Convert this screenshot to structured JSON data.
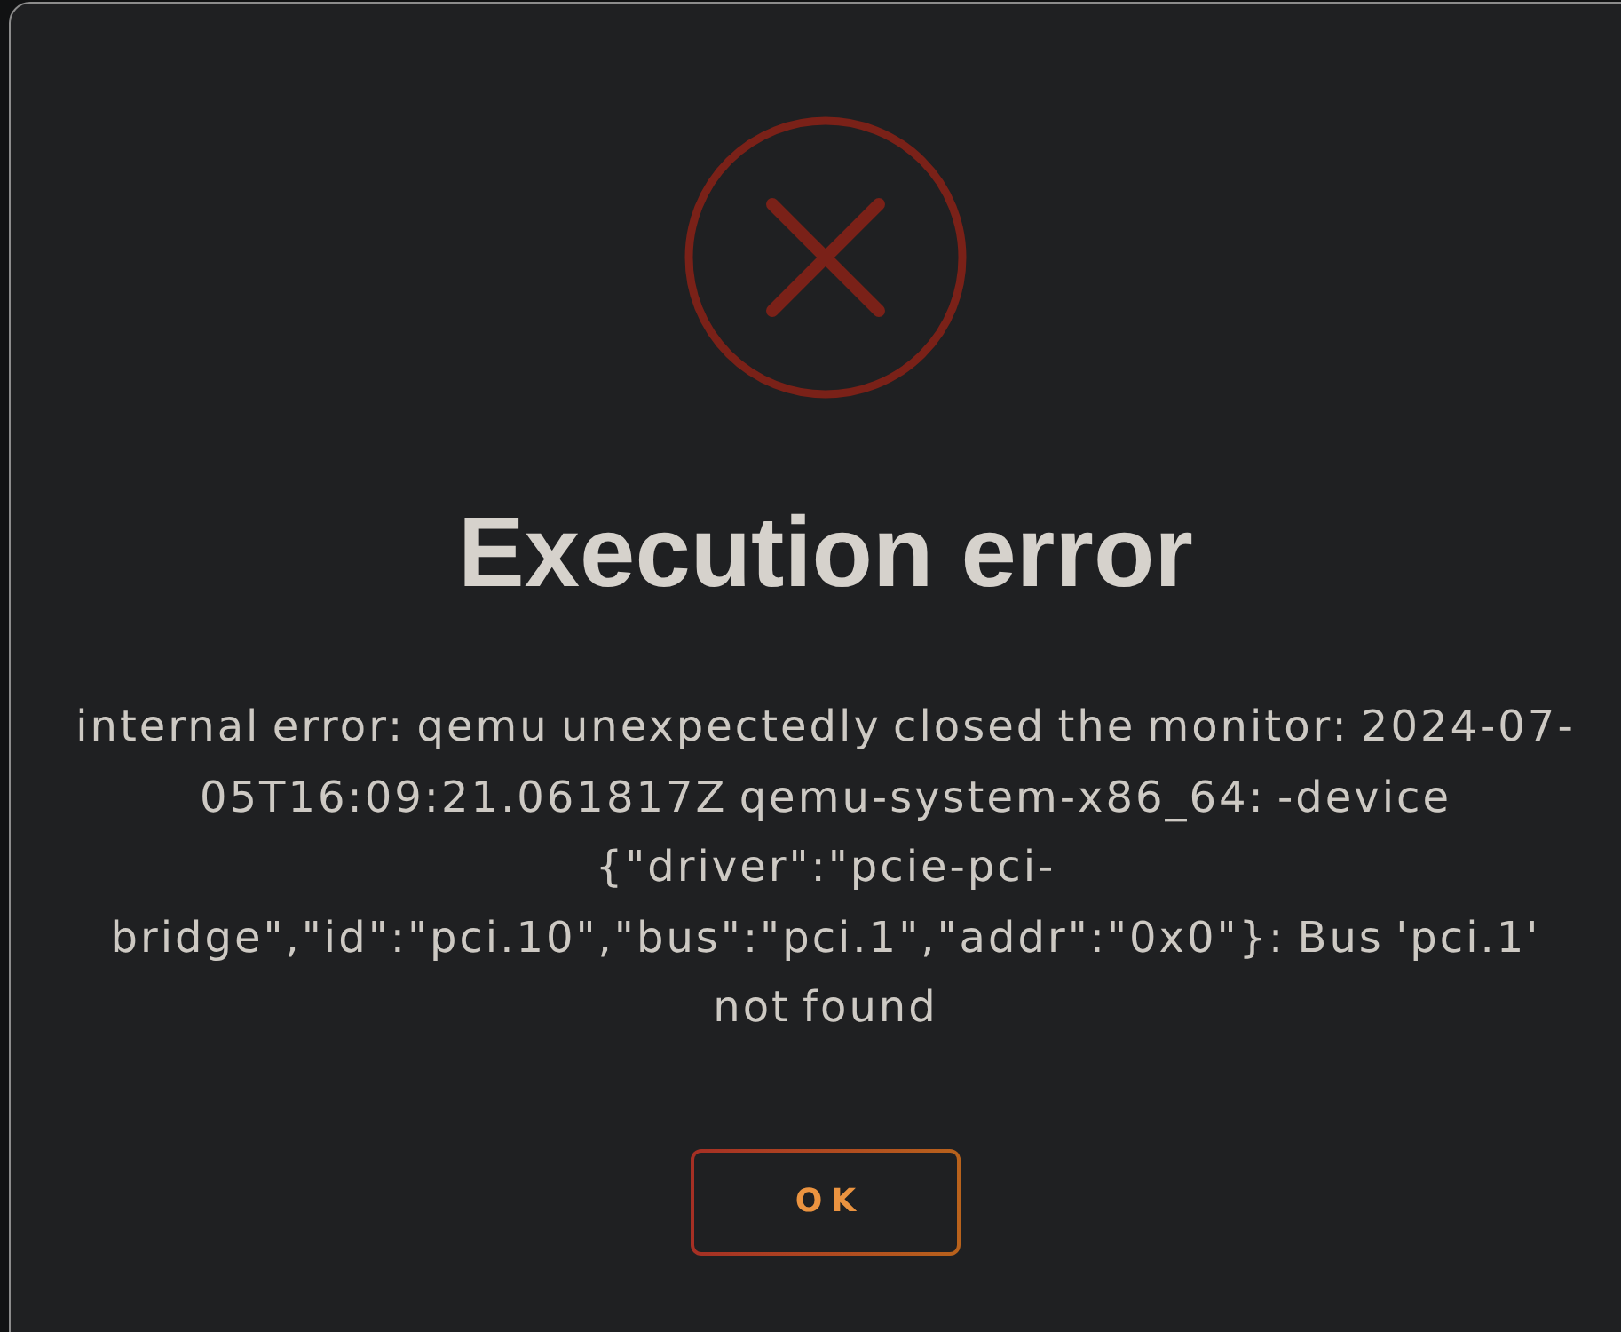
{
  "dialog": {
    "title": "Execution error",
    "message": "internal error: qemu unexpectedly closed the monitor: 2024-07-05T16:09:21.061817Z qemu-system-x86_64: -device {\"driver\":\"pcie-pci-bridge\",\"id\":\"pci.10\",\"bus\":\"pci.1\",\"addr\":\"0x0\"}: Bus 'pci.1' not found",
    "buttons": [
      "OK"
    ]
  }
}
